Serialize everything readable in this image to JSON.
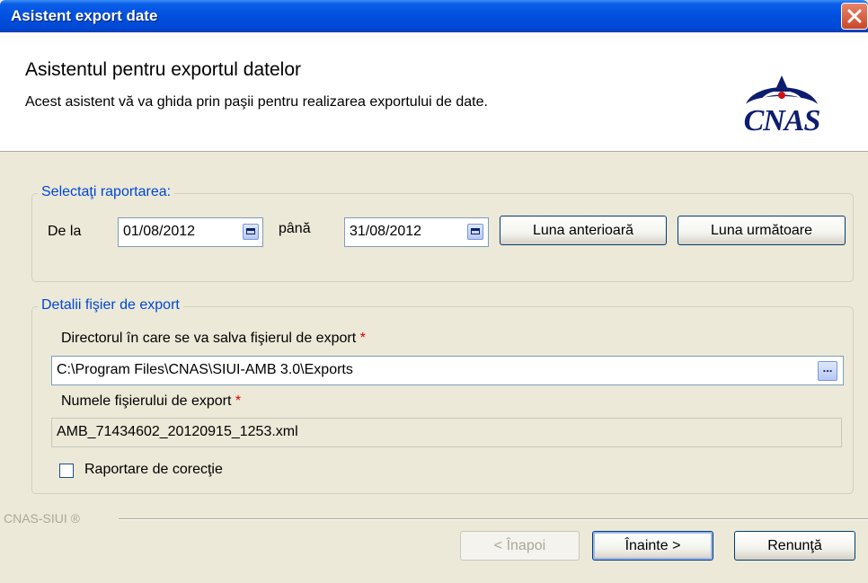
{
  "window": {
    "title": "Asistent export date"
  },
  "header": {
    "title": "Asistentul pentru exportul datelor",
    "subtitle": "Acest asistent vă va ghida prin paşii pentru realizarea exportului de date.",
    "logo_text": "CNAS",
    "logo_color": "#0d1d6e"
  },
  "period": {
    "legend": "Selectaţi raportarea:",
    "from_label": "De la",
    "from_value": "01/08/2012",
    "to_label": "până",
    "to_value": "31/08/2012",
    "prev_month_label": "Luna anterioară",
    "next_month_label": "Luna următoare"
  },
  "export": {
    "legend": "Detalii fişier de export",
    "dir_label": "Directorul în care se va salva fişierul de export",
    "dir_required": "*",
    "dir_value": "C:\\Program Files\\CNAS\\SIUI-AMB 3.0\\Exports",
    "browse_label": "...",
    "file_label": "Numele fişierului de export",
    "file_required": "*",
    "file_value": "AMB_71434602_20120915_1253.xml",
    "correction_label": "Raportare de corecţie",
    "correction_checked": false
  },
  "footer": {
    "brand": "CNAS-SIUI ®",
    "back_label": "< Înapoi",
    "next_label": "Înainte >",
    "cancel_label": "Renunţă"
  },
  "colors": {
    "titlebar": "#0050e0",
    "legend_text": "#0046d5",
    "required": "#e00000",
    "close_button": "#c9482a"
  }
}
